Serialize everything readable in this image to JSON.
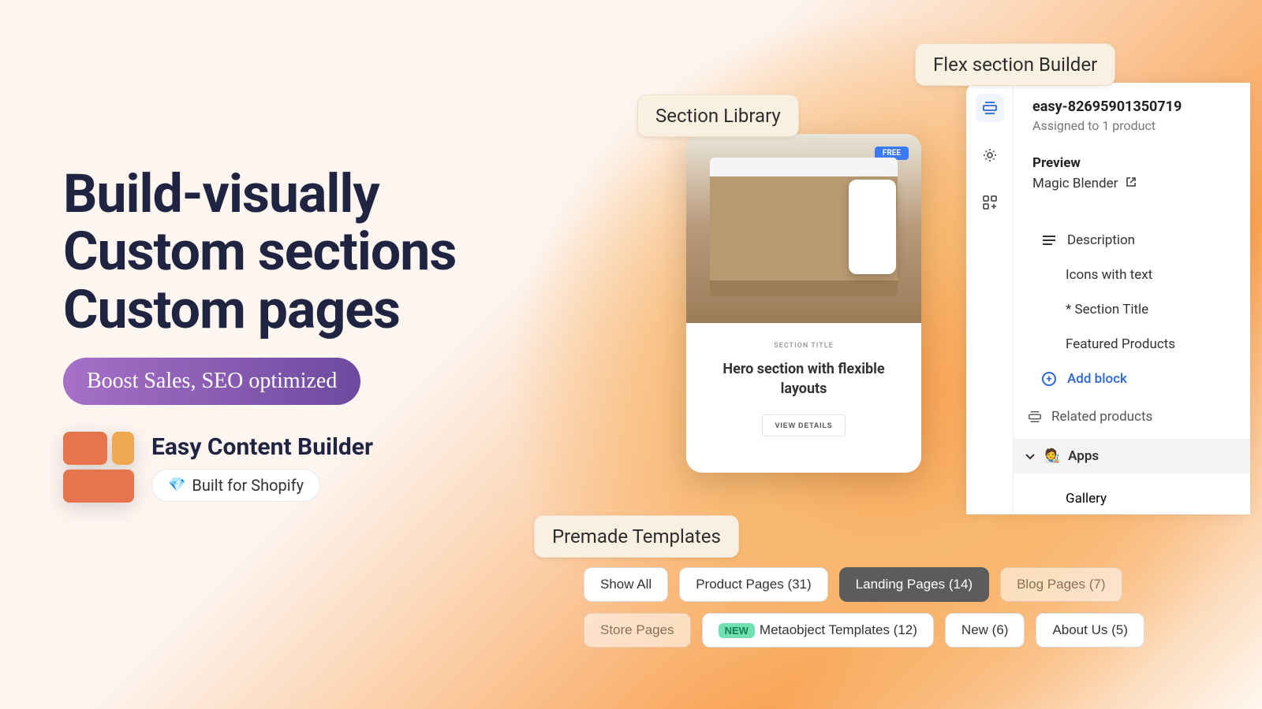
{
  "headline": {
    "line1": "Build-visually",
    "line2": "Custom sections",
    "line3": "Custom pages"
  },
  "boost_pill": "Boost Sales, SEO optimized",
  "app": {
    "title": "Easy Content Builder",
    "badge": "Built for Shopify",
    "gem": "💎"
  },
  "labels": {
    "section_library": "Section Library",
    "flex_builder": "Flex section Builder",
    "premade_templates": "Premade Templates"
  },
  "section_card": {
    "free": "FREE",
    "subtitle": "SECTION TITLE",
    "title": "Hero section with flexible layouts",
    "button": "VIEW DETAILS"
  },
  "builder": {
    "id": "easy-82695901350719",
    "assigned": "Assigned to 1 product",
    "preview_label": "Preview",
    "preview_name": "Magic Blender",
    "blocks": [
      {
        "icon": "lines",
        "label": "Description"
      },
      {
        "icon": "grid",
        "label": "Icons with text"
      },
      {
        "icon": "grid",
        "label": "* Section Title"
      },
      {
        "icon": "grid",
        "label": "Featured Products"
      }
    ],
    "add_block": "Add block",
    "related": "Related products",
    "apps": "Apps",
    "gallery": "Gallery"
  },
  "filters": [
    {
      "label": "Show All",
      "count": null,
      "active": false,
      "new": false
    },
    {
      "label": "Product Pages",
      "count": 31,
      "active": false,
      "new": false
    },
    {
      "label": "Landing Pages",
      "count": 14,
      "active": true,
      "new": false
    },
    {
      "label": "Blog Pages",
      "count": 7,
      "active": false,
      "new": false,
      "faded": true
    },
    {
      "label": "Store Pages",
      "count": null,
      "active": false,
      "new": false,
      "faded": true
    },
    {
      "label": "Metaobject Templates",
      "count": 12,
      "active": false,
      "new": true
    },
    {
      "label": "New",
      "count": 6,
      "active": false,
      "new": false
    },
    {
      "label": "About Us",
      "count": 5,
      "active": false,
      "new": false
    }
  ]
}
